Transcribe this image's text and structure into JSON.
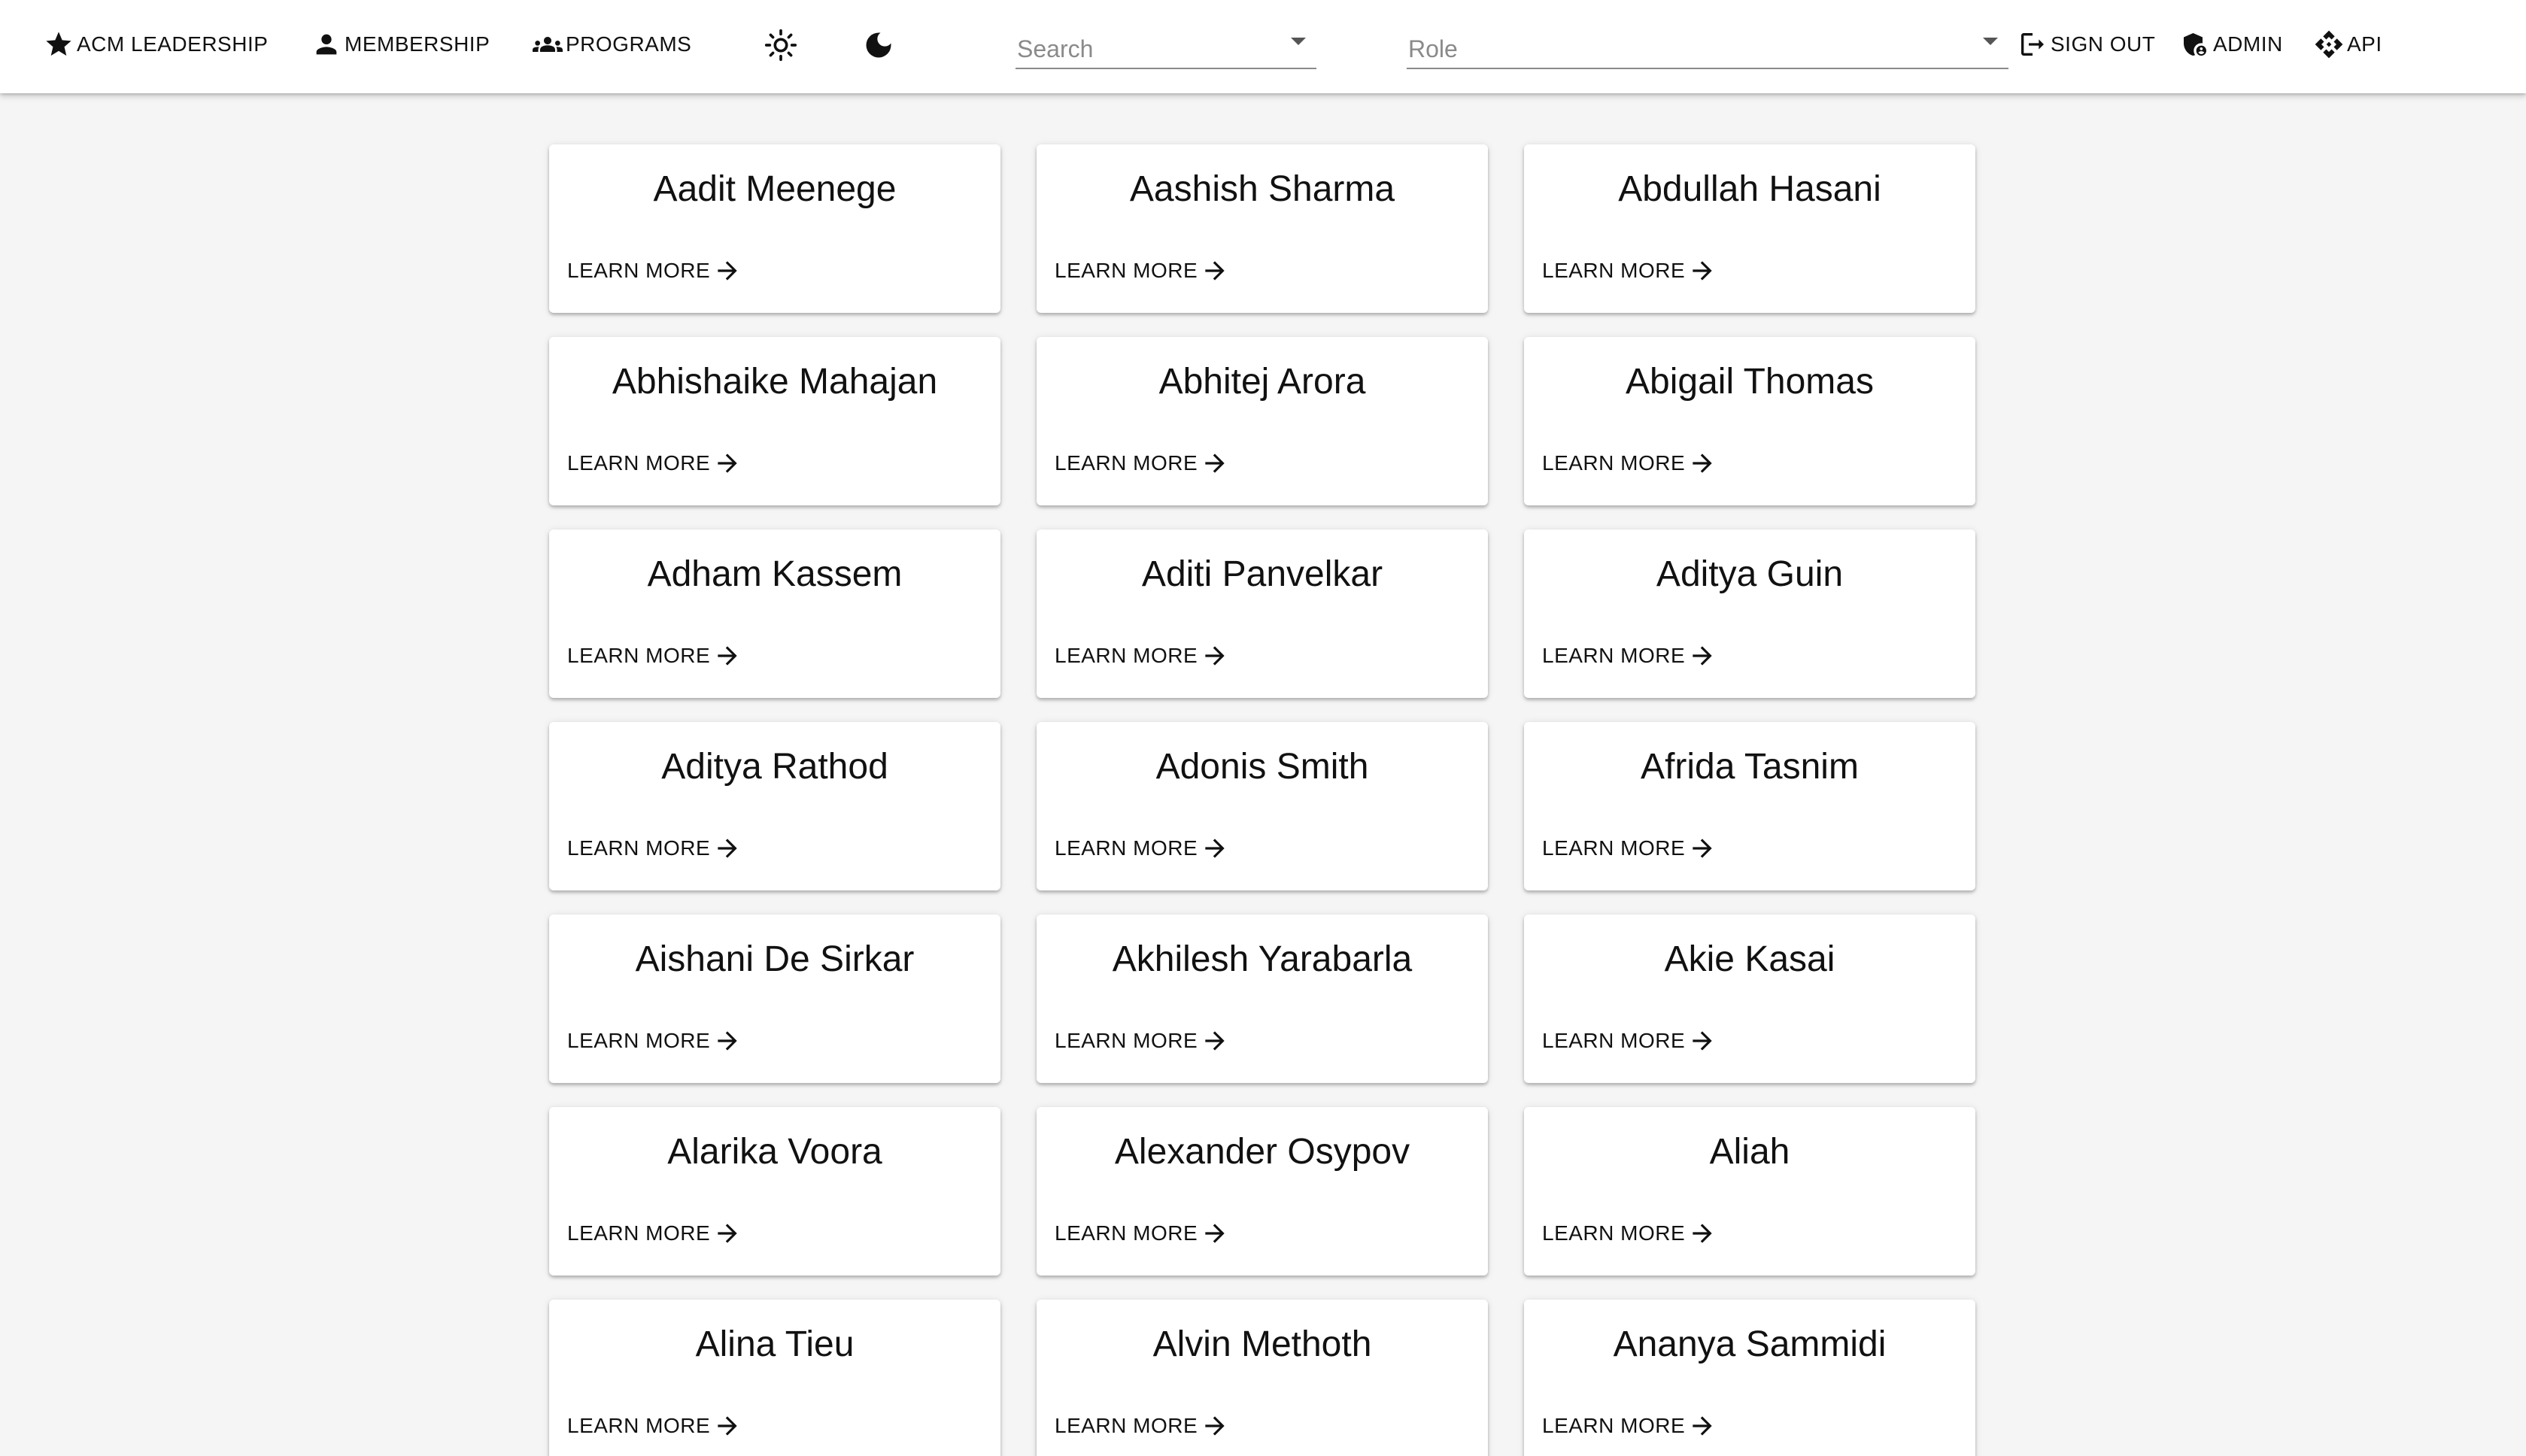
{
  "nav": {
    "leadership": "ACM LEADERSHIP",
    "membership": "MEMBERSHIP",
    "programs": "PROGRAMS",
    "sign_out": "SIGN OUT",
    "admin": "ADMIN",
    "api": "API"
  },
  "search": {
    "placeholder": "Search"
  },
  "role": {
    "placeholder": "Role"
  },
  "card_action_label": "LEARN MORE",
  "people": [
    "Aadit Meenege",
    "Aashish Sharma",
    "Abdullah Hasani",
    "Abhishaike Mahajan",
    "Abhitej Arora",
    "Abigail Thomas",
    "Adham Kassem",
    "Aditi Panvelkar",
    "Aditya Guin",
    "Aditya Rathod",
    "Adonis Smith",
    "Afrida Tasnim",
    "Aishani De Sirkar",
    "Akhilesh Yarabarla",
    "Akie Kasai",
    "Alarika Voora",
    "Alexander Osypov",
    "Aliah",
    "Alina Tieu",
    "Alvin Methoth",
    "Ananya Sammidi"
  ],
  "icons": {
    "leadership": "star-icon",
    "membership": "person-icon",
    "programs": "groups-icon",
    "light_mode": "sun-icon",
    "dark_mode": "moon-icon",
    "sign_out": "logout-icon",
    "admin": "admin-shield-icon",
    "api": "api-icon",
    "card_action": "arrow-forward-icon"
  }
}
